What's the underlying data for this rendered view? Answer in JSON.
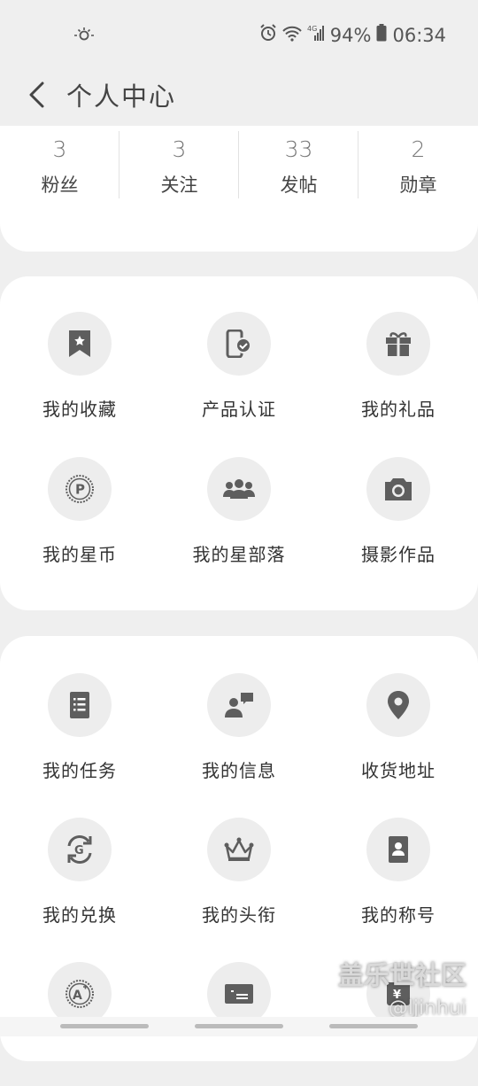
{
  "status_bar": {
    "battery": "94%",
    "time": "06:34",
    "network": "4G"
  },
  "header": {
    "title": "个人中心"
  },
  "stats": [
    {
      "value": "3",
      "label": "粉丝"
    },
    {
      "value": "3",
      "label": "关注"
    },
    {
      "value": "33",
      "label": "发帖"
    },
    {
      "value": "2",
      "label": "勋章"
    }
  ],
  "card1": {
    "items": [
      {
        "label": "我的收藏",
        "icon": "bookmark-star-icon"
      },
      {
        "label": "产品认证",
        "icon": "phone-verified-icon"
      },
      {
        "label": "我的礼品",
        "icon": "gift-icon"
      },
      {
        "label": "我的星币",
        "icon": "coin-p-icon"
      },
      {
        "label": "我的星部落",
        "icon": "group-icon"
      },
      {
        "label": "摄影作品",
        "icon": "camera-icon"
      }
    ]
  },
  "card2": {
    "items": [
      {
        "label": "我的任务",
        "icon": "task-list-icon"
      },
      {
        "label": "我的信息",
        "icon": "user-message-icon"
      },
      {
        "label": "收货地址",
        "icon": "location-pin-icon"
      },
      {
        "label": "我的兑换",
        "icon": "exchange-g-icon"
      },
      {
        "label": "我的头衔",
        "icon": "crown-icon"
      },
      {
        "label": "我的称号",
        "icon": "id-badge-icon"
      }
    ]
  },
  "watermark": {
    "line1": "盖乐世社区",
    "line2": "@ljinhui"
  },
  "colors": {
    "background": "#efefef",
    "card": "#ffffff",
    "icon": "#5e5e5e",
    "icon_circle": "#ededed"
  }
}
